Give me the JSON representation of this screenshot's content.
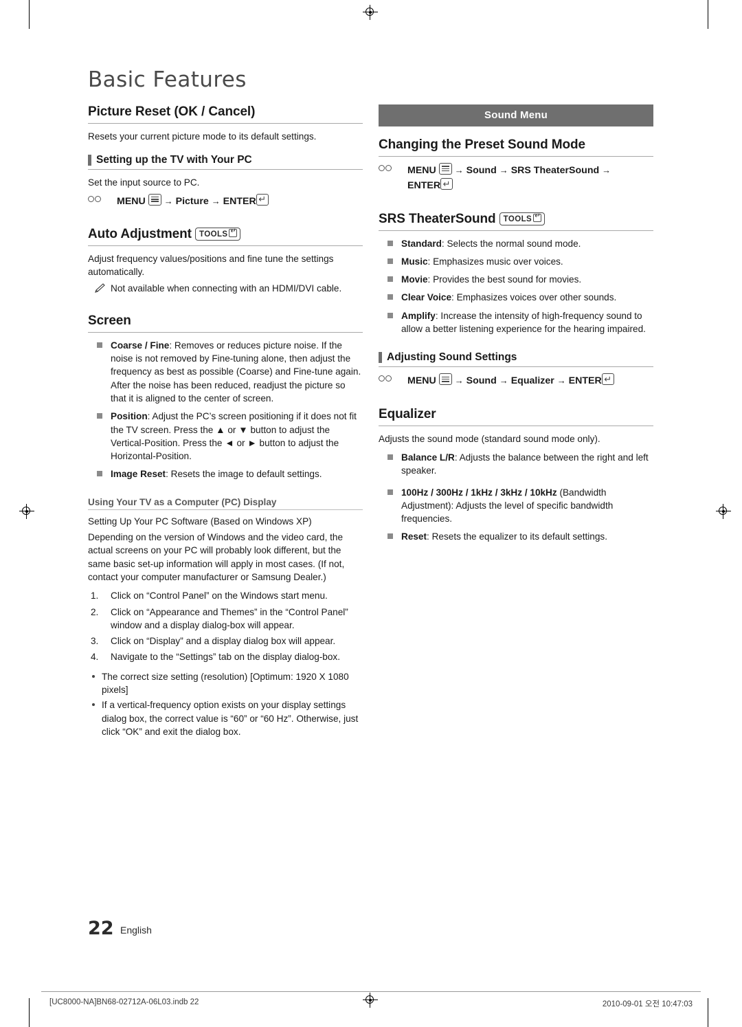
{
  "page": {
    "title": "Basic Features",
    "number": "22",
    "language": "English",
    "footer_left": "[UC8000-NA]BN68-02712A-06L03.indb   22",
    "footer_right": "2010-09-01   오전 10:47:03"
  },
  "left": {
    "picture_reset": {
      "heading": "Picture Reset (OK / Cancel)",
      "body": "Resets your current picture mode to its default settings."
    },
    "setting_up_pc": {
      "heading": "Setting up the TV with Your PC",
      "body": "Set the input source to PC.",
      "path_prefix": "MENU",
      "path_mid": "Picture",
      "path_end": "ENTER"
    },
    "auto_adjustment": {
      "heading": "Auto Adjustment",
      "tools_label": "TOOLS",
      "body": "Adjust frequency values/positions and fine tune the settings automatically.",
      "note": "Not available when connecting with an HDMI/DVI cable."
    },
    "screen": {
      "heading": "Screen",
      "items": [
        {
          "label": "Coarse / Fine",
          "text": ": Removes or reduces picture noise. If the noise is not removed by Fine-tuning alone, then adjust the frequency as best as possible (Coarse) and Fine-tune again. After the noise has been reduced, readjust the picture so that it is aligned to the center of screen."
        },
        {
          "label": "Position",
          "text": ": Adjust the PC’s screen positioning if it does not fit the TV screen. Press the ▲ or ▼ button to adjust the Vertical-Position. Press the ◄ or ► button to adjust the Horizontal-Position."
        },
        {
          "label": "Image Reset",
          "text": ": Resets the image to default settings."
        }
      ]
    },
    "pc_display": {
      "heading": "Using Your TV as a Computer (PC) Display",
      "sub": "Setting Up Your PC Software (Based on Windows XP)",
      "body": "Depending on the version of Windows and the video card, the actual screens on your PC will probably look different, but the same basic set-up information will apply in most cases. (If not, contact your computer manufacturer or Samsung Dealer.)",
      "steps": [
        "Click on “Control Panel” on the Windows start menu.",
        "Click on “Appearance and Themes” in the “Control Panel” window and a display dialog-box will appear.",
        "Click on “Display” and a display dialog box will appear.",
        "Navigate to the “Settings” tab on the display dialog-box."
      ],
      "notes": [
        "The correct size setting (resolution) [Optimum: 1920 X 1080 pixels]",
        "If a vertical-frequency option exists on your display settings dialog box, the correct value is “60” or “60 Hz”. Otherwise, just click “OK” and exit the dialog box."
      ]
    }
  },
  "right": {
    "banner": "Sound Menu",
    "preset_sound": {
      "heading": "Changing the Preset Sound Mode",
      "path_prefix": "MENU",
      "path_mid": "Sound",
      "path_mid2": "SRS TheaterSound",
      "path_end": "ENTER"
    },
    "srs": {
      "heading": "SRS TheaterSound",
      "tools_label": "TOOLS",
      "items": [
        {
          "label": "Standard",
          "text": ": Selects the normal sound mode."
        },
        {
          "label": "Music",
          "text": ": Emphasizes music over voices."
        },
        {
          "label": "Movie",
          "text": ": Provides the best sound for movies."
        },
        {
          "label": "Clear Voice",
          "text": ": Emphasizes voices over other sounds."
        },
        {
          "label": "Amplify",
          "text": ": Increase the intensity of high-frequency sound to allow a better listening experience for the hearing impaired."
        }
      ]
    },
    "adjusting_sound": {
      "heading": "Adjusting Sound Settings",
      "path_prefix": "MENU",
      "path_mid": "Sound",
      "path_mid2": "Equalizer",
      "path_end": "ENTER"
    },
    "equalizer": {
      "heading": "Equalizer",
      "body": "Adjusts the sound mode (standard sound mode only).",
      "items": [
        {
          "label": "Balance L/R",
          "text": ": Adjusts the balance between the right and left speaker."
        },
        {
          "label": "100Hz / 300Hz / 1kHz / 3kHz / 10kHz",
          "text": " (Bandwidth Adjustment): Adjusts the level of specific bandwidth frequencies."
        },
        {
          "label": "Reset",
          "text": ": Resets the equalizer to its default settings."
        }
      ]
    }
  }
}
